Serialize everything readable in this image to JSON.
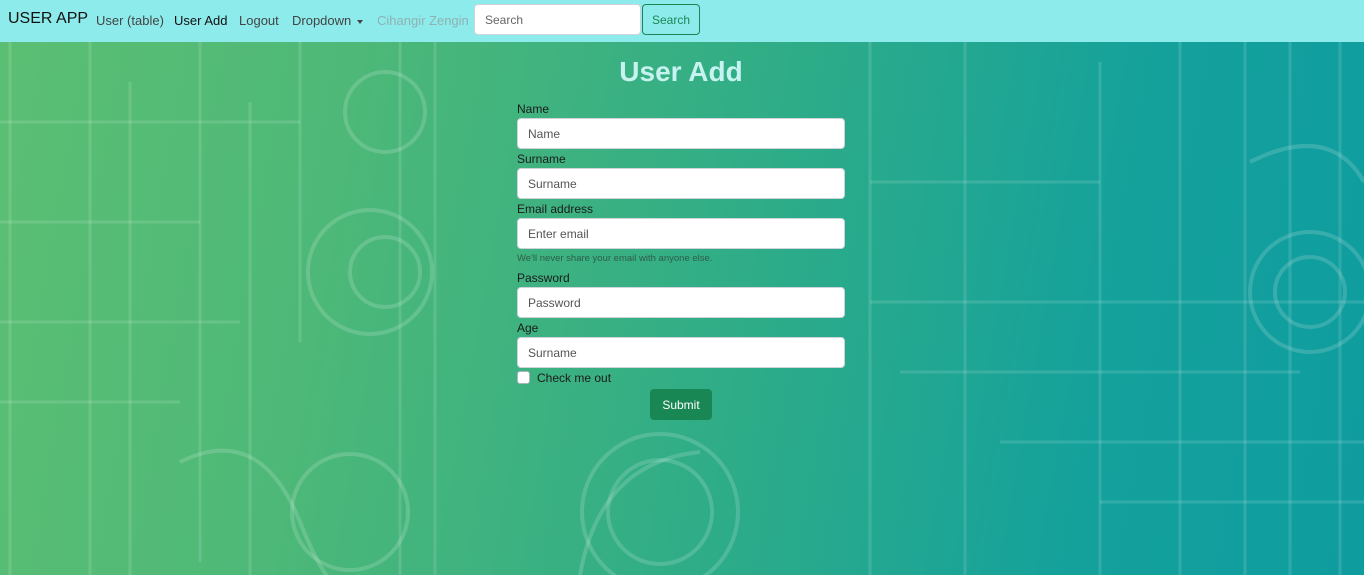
{
  "navbar": {
    "brand": "USER APP",
    "links": [
      {
        "label": "User (table)"
      },
      {
        "label": "User Add"
      },
      {
        "label": "Logout"
      },
      {
        "label": "Dropdown"
      },
      {
        "label": "Cihangir Zengin"
      }
    ],
    "search": {
      "placeholder": "Search",
      "value": "",
      "button_label": "Search"
    }
  },
  "form": {
    "title": "User Add",
    "fields": [
      {
        "label": "Name",
        "placeholder": "Name"
      },
      {
        "label": "Surname",
        "placeholder": "Surname"
      },
      {
        "label": "Email address",
        "placeholder": "Enter email"
      },
      {
        "label": "Password",
        "placeholder": "Password"
      },
      {
        "label": "Age",
        "placeholder": "Surname"
      }
    ],
    "email_help": "We'll never share your email with anyone else.",
    "checkbox_label": "Check me out",
    "checkbox_checked": false,
    "submit_label": "Submit"
  },
  "icons": {
    "dropdown": "chevron-down-icon"
  },
  "colors": {
    "navbar_bg": "#8eebeb",
    "accent_green": "#198754",
    "title_color": "#c6f2f0"
  }
}
